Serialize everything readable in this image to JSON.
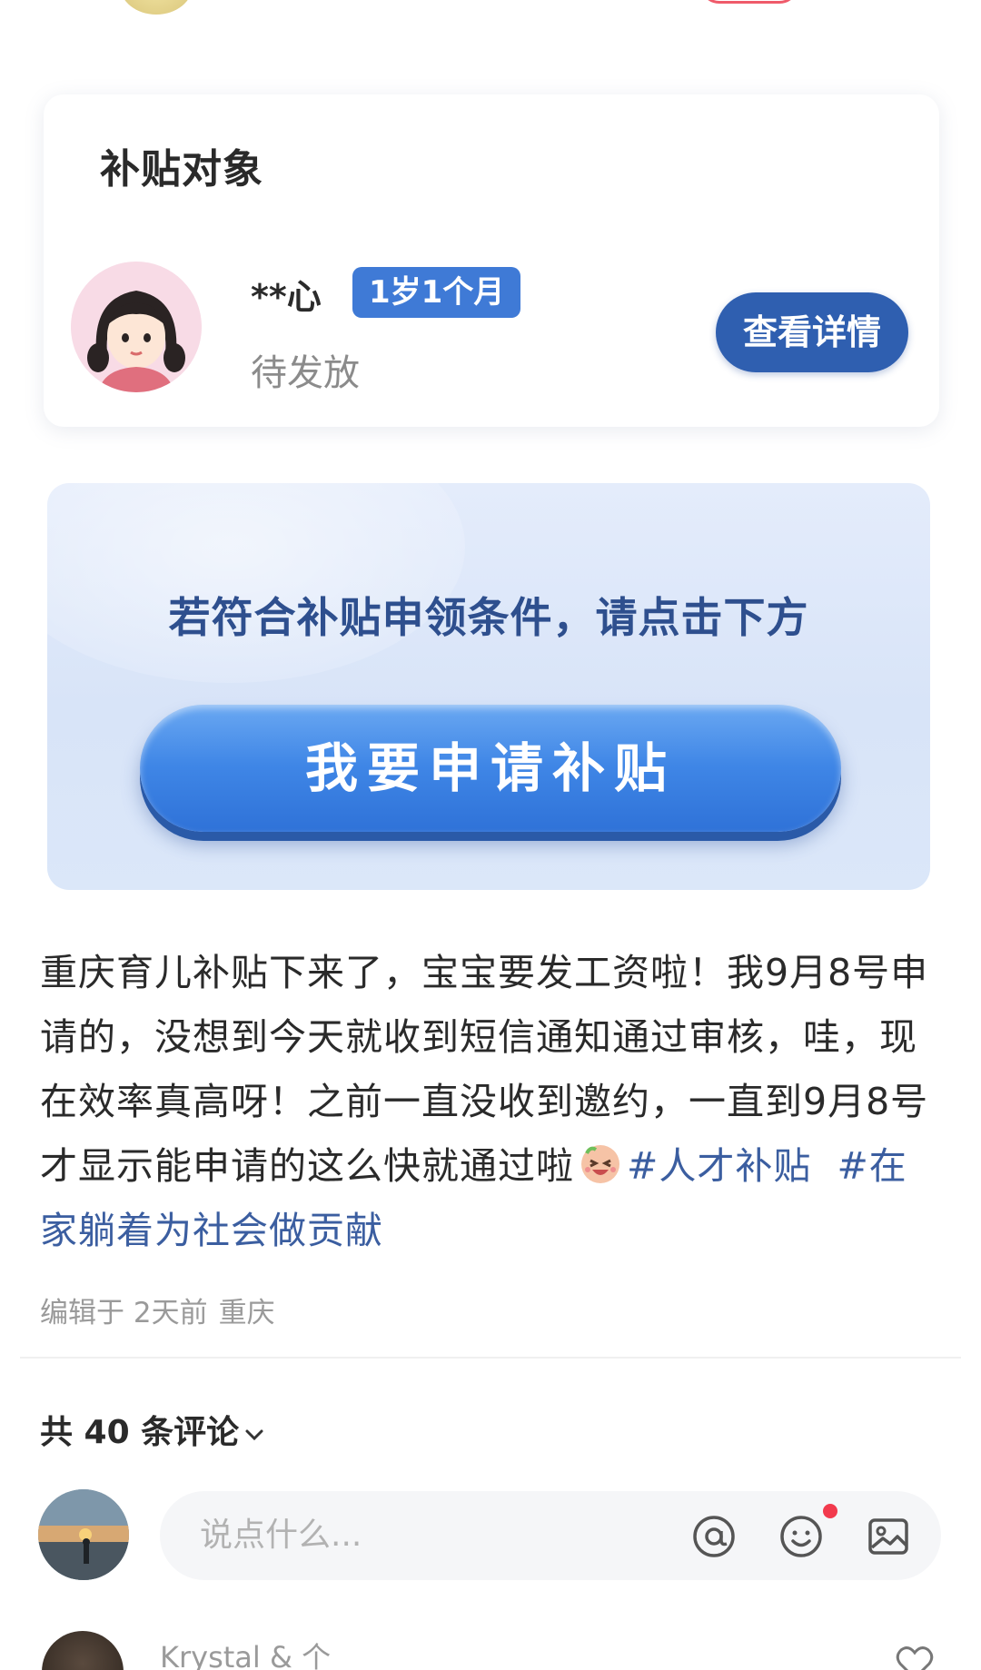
{
  "card": {
    "title": "补贴对象",
    "child_name": "**心",
    "age_badge": "1岁1个月",
    "status": "待发放",
    "detail_button": "查看详情"
  },
  "banner": {
    "prompt": "若符合补贴申领条件，请点击下方",
    "apply_button": "我要申请补贴"
  },
  "post": {
    "text_main": "重庆育儿补贴下来了，宝宝要发工资啦！我9月8号申请的，没想到今天就收到短信通知通过审核，哇，现在效率真高呀！之前一直没收到邀约，一直到9月8号才显示能申请的这么快就通过啦",
    "emoji": "laughing-face-emoji",
    "hashtags": [
      "#人才补贴",
      "#在家躺着为社会做贡献"
    ],
    "meta_edit": "编辑于 2天前",
    "meta_location": "重庆"
  },
  "comments": {
    "count_label": "共 40 条评论",
    "input_placeholder": "说点什么...",
    "next_user": "Krystal & 个"
  },
  "colors": {
    "accent": "#2f5fb0",
    "badge": "#3f7ad6",
    "hashtag": "#3b5ea0",
    "notification_dot": "#f23a4d"
  }
}
